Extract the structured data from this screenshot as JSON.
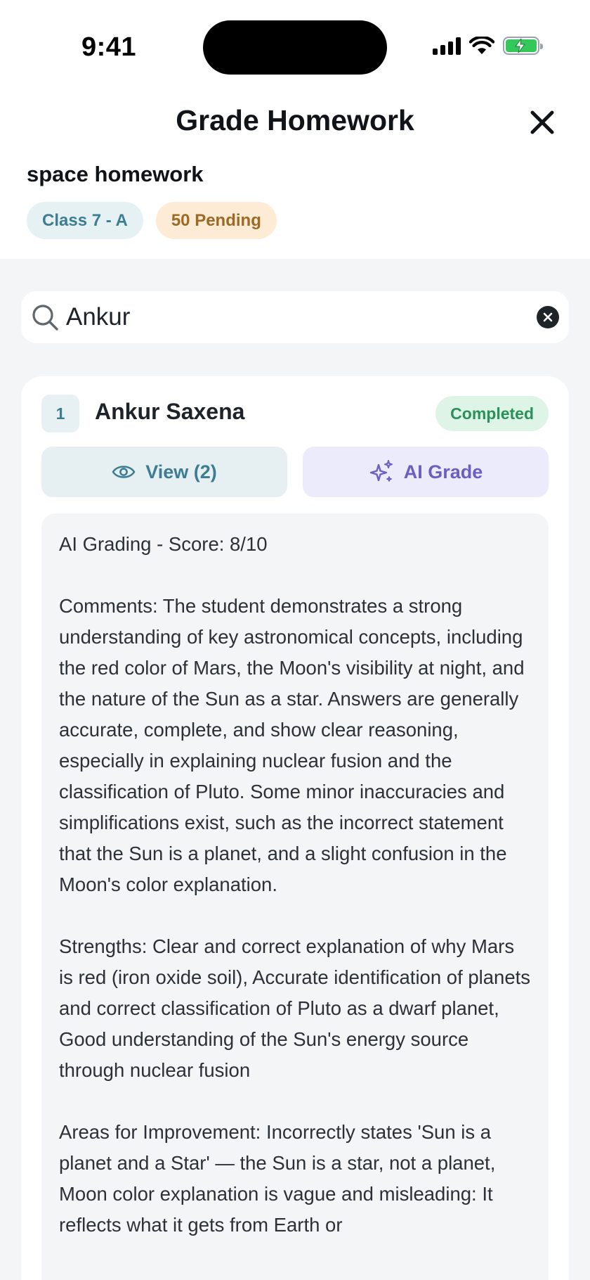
{
  "status_bar": {
    "time": "9:41"
  },
  "header": {
    "title": "Grade Homework",
    "close_icon": "close-icon"
  },
  "homework": {
    "title": "space homework",
    "class_chip": "Class 7 - A",
    "pending_chip": "50 Pending"
  },
  "search": {
    "value": "Ankur",
    "icon": "search-icon",
    "clear_icon": "clear-icon"
  },
  "student": {
    "number": "1",
    "name": "Ankur Saxena",
    "status": "Completed",
    "view_label": "View (2)",
    "view_icon": "eye-icon",
    "ai_label": "AI Grade",
    "ai_icon": "sparkles-icon",
    "feedback": {
      "score_line": "AI Grading - Score: 8/10",
      "comments": "Comments: The student demonstrates a strong understanding of key astronomical concepts, including the red color of Mars, the Moon's visibility at night, and the nature of the Sun as a star. Answers are generally accurate, complete, and show clear reasoning, especially in explaining nuclear fusion and the classification of Pluto. Some minor inaccuracies and simplifications exist, such as the incorrect statement that the Sun is a planet, and a slight confusion in the Moon's color explanation.",
      "strengths": "Strengths: Clear and correct explanation of why Mars is red (iron oxide soil), Accurate identification of planets and correct classification of Pluto as a dwarf planet, Good understanding of the Sun's energy source through nuclear fusion",
      "improvements": "Areas for Improvement: Incorrectly states 'Sun is a planet and a Star' — the Sun is a star, not a planet, Moon color explanation is vague and misleading: It reflects what it gets from Earth or"
    }
  },
  "colors": {
    "accent_teal": "#3d7d92",
    "completed_green": "#2a915a",
    "pending_orange": "#9b6a24",
    "ai_purple": "#6c5fc2"
  }
}
